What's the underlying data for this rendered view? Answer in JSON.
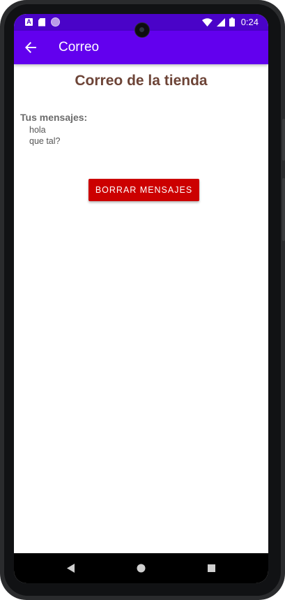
{
  "status_bar": {
    "time": "0:24",
    "left_icons": [
      "a-notification-icon",
      "sd-card-icon",
      "circle-notification-icon"
    ],
    "right_icons": [
      "wifi-icon",
      "signal-icon",
      "battery-icon"
    ]
  },
  "app_bar": {
    "title": "Correo",
    "back_icon": "arrow-back-icon",
    "color": "#6200ee"
  },
  "content": {
    "page_title": "Correo de la tienda",
    "messages_label": "Tus mensajes:",
    "messages": [
      "hola",
      "que tal?"
    ],
    "delete_button_label": "BORRAR MENSAJES",
    "delete_button_color": "#cc0000",
    "title_color": "#6d4437"
  },
  "nav_bar": {
    "buttons": [
      "back-triangle-icon",
      "home-circle-icon",
      "recents-square-icon"
    ]
  }
}
